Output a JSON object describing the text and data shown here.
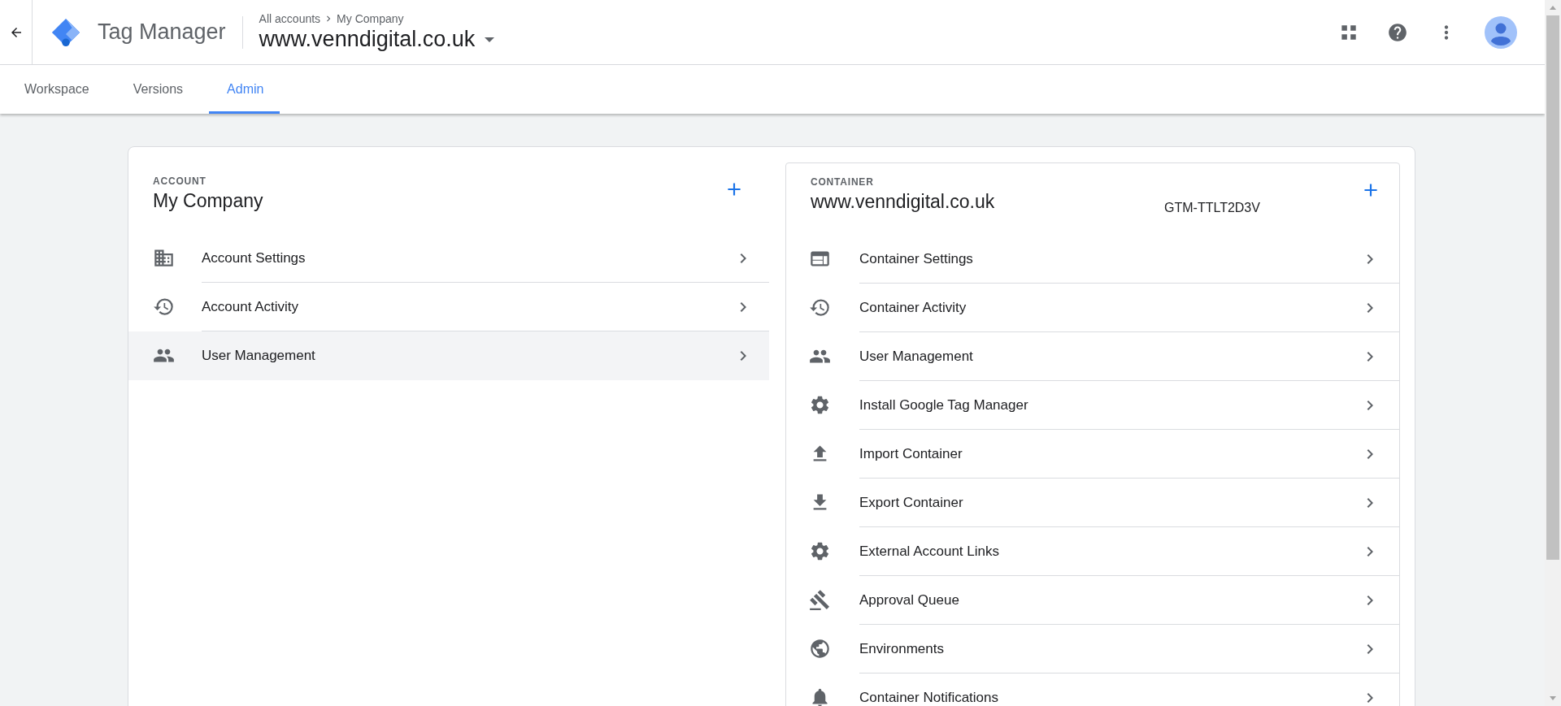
{
  "header": {
    "app_name": "Tag Manager",
    "breadcrumb": [
      {
        "label": "All accounts"
      },
      {
        "label": "My Company"
      }
    ],
    "container_name": "www.venndigital.co.uk"
  },
  "tabs": [
    {
      "label": "Workspace",
      "selected": false
    },
    {
      "label": "Versions",
      "selected": false
    },
    {
      "label": "Admin",
      "selected": true
    }
  ],
  "account": {
    "label": "ACCOUNT",
    "name": "My Company",
    "items": [
      {
        "label": "Account Settings",
        "kind": "building",
        "highlighted": false
      },
      {
        "label": "Account Activity",
        "kind": "history",
        "highlighted": false
      },
      {
        "label": "User Management",
        "kind": "people",
        "highlighted": true
      }
    ]
  },
  "container": {
    "label": "CONTAINER",
    "name": "www.venndigital.co.uk",
    "id": "GTM-TTLT2D3V",
    "items": [
      {
        "label": "Container Settings",
        "kind": "layout"
      },
      {
        "label": "Container Activity",
        "kind": "history"
      },
      {
        "label": "User Management",
        "kind": "people"
      },
      {
        "label": "Install Google Tag Manager",
        "kind": "gear"
      },
      {
        "label": "Import Container",
        "kind": "upload"
      },
      {
        "label": "Export Container",
        "kind": "download"
      },
      {
        "label": "External Account Links",
        "kind": "gear"
      },
      {
        "label": "Approval Queue",
        "kind": "gavel"
      },
      {
        "label": "Environments",
        "kind": "globe"
      },
      {
        "label": "Container Notifications",
        "kind": "bell"
      }
    ]
  }
}
